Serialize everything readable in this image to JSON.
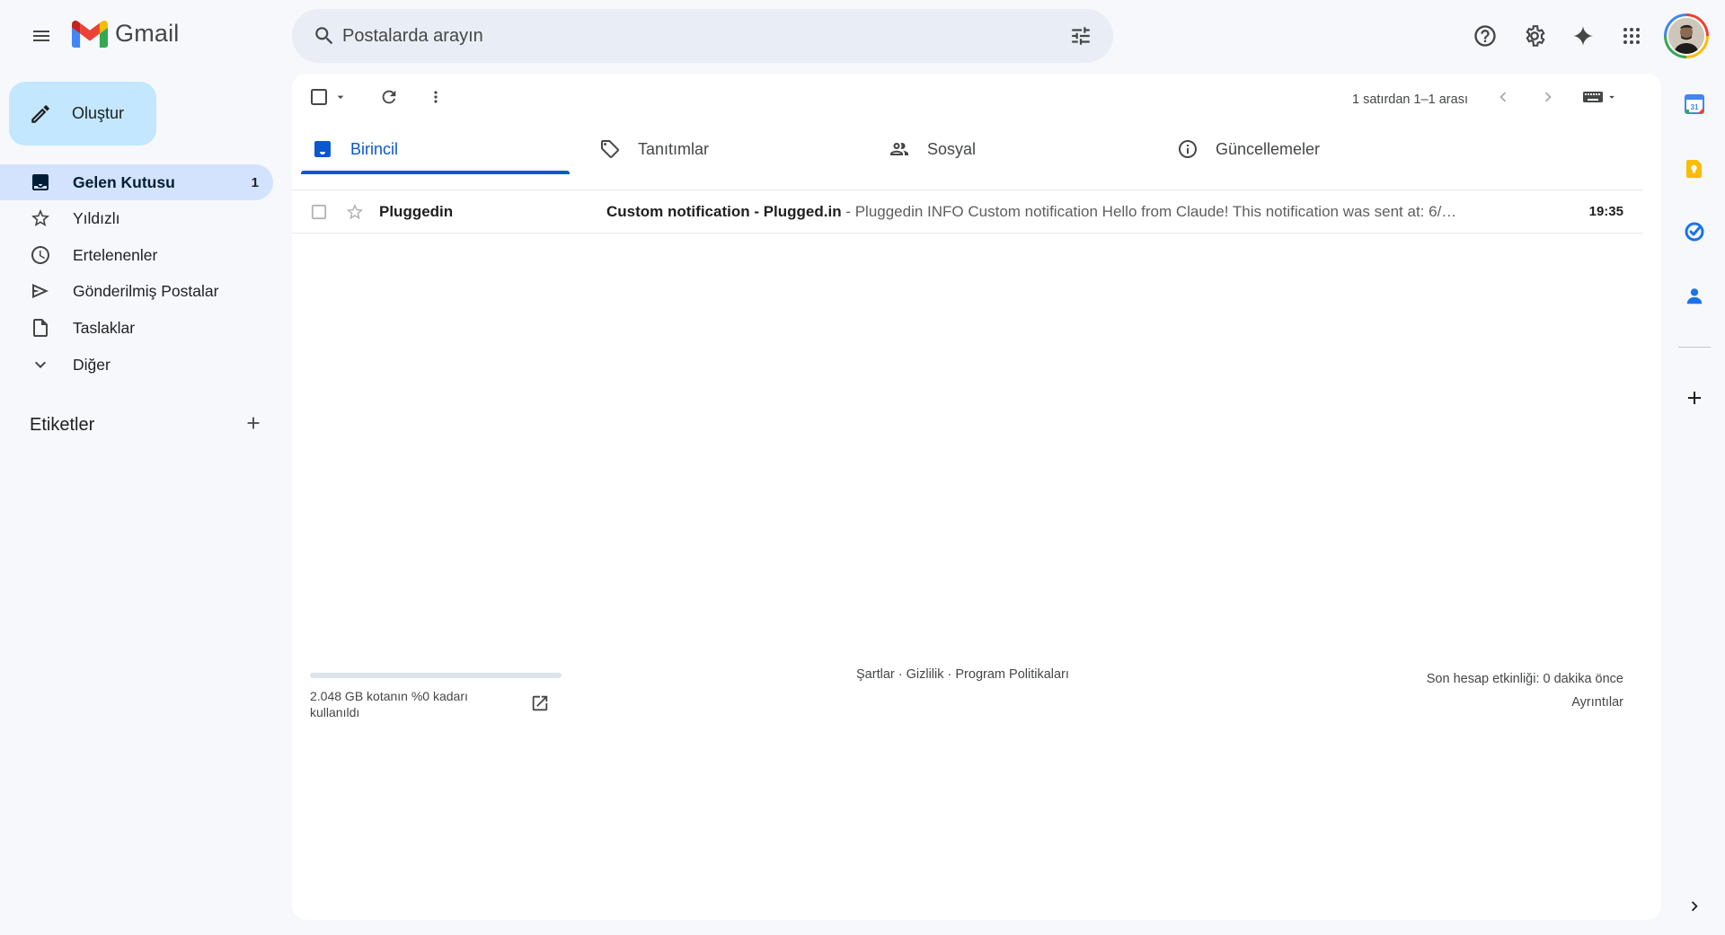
{
  "header": {
    "logo_text": "Gmail",
    "search_placeholder": "Postalarda arayın"
  },
  "sidebar": {
    "compose_label": "Oluştur",
    "items": [
      {
        "label": "Gelen Kutusu",
        "count": "1",
        "icon": "inbox-icon",
        "active": true
      },
      {
        "label": "Yıldızlı",
        "icon": "star-icon"
      },
      {
        "label": "Ertelenenler",
        "icon": "clock-icon"
      },
      {
        "label": "Gönderilmiş Postalar",
        "icon": "send-icon"
      },
      {
        "label": "Taslaklar",
        "icon": "draft-icon"
      },
      {
        "label": "Diğer",
        "icon": "chevron-down-icon"
      }
    ],
    "labels_title": "Etiketler"
  },
  "toolbar": {
    "pager_text": "1 satırdan 1–1 arası"
  },
  "tabs": [
    {
      "label": "Birincil",
      "icon": "inbox-icon",
      "active": true
    },
    {
      "label": "Tanıtımlar",
      "icon": "tag-icon"
    },
    {
      "label": "Sosyal",
      "icon": "people-icon"
    },
    {
      "label": "Güncellemeler",
      "icon": "info-icon"
    }
  ],
  "emails": [
    {
      "sender": "Pluggedin",
      "subject": "Custom notification - Plugged.in",
      "snippet": " - Pluggedin INFO Custom notification Hello from Claude! This notification was sent at: 6/…",
      "time": "19:35"
    }
  ],
  "footer": {
    "storage_text": "2.048 GB kotanın %0 kadarı kullanıldı",
    "storage_used_percent": 0,
    "terms": "Şartlar",
    "privacy": "Gizlilik",
    "policies": "Program Politikaları",
    "separator": " · ",
    "activity": "Son hesap etkinliği: 0 dakika önce",
    "details": "Ayrıntılar"
  },
  "colors": {
    "background": "#f6f8fc",
    "compose": "#c2e7ff",
    "active_nav": "#d3e3fd",
    "accent": "#0b57d0"
  }
}
